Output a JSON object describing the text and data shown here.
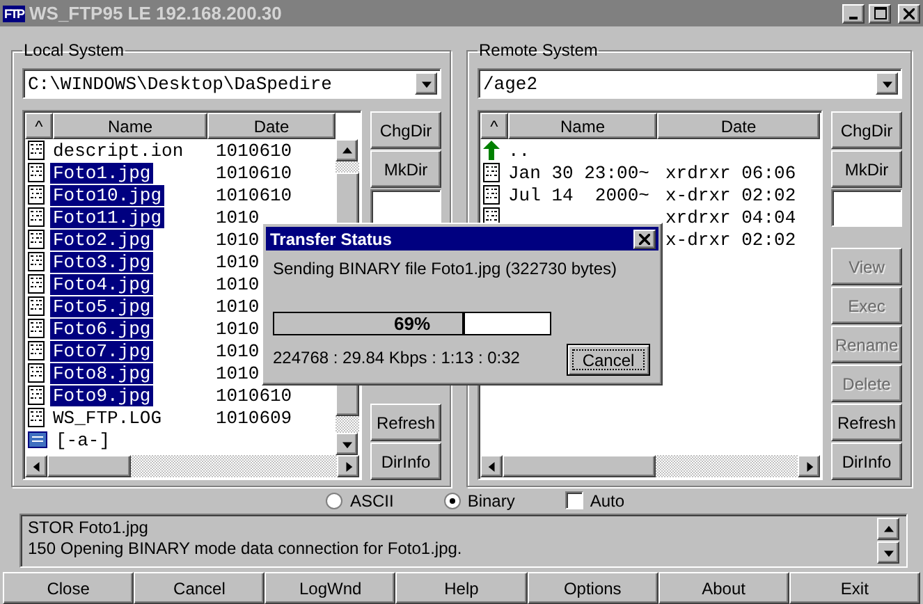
{
  "window": {
    "title": "WS_FTP95 LE 192.168.200.30",
    "logo": "FTP"
  },
  "local": {
    "title": "Local System",
    "path": "C:\\WINDOWS\\Desktop\\DaSpedire",
    "columns": [
      "^",
      "Name",
      "Date"
    ],
    "rows": [
      {
        "kind": "file",
        "name": "descript.ion",
        "date": "1010610",
        "selected": false
      },
      {
        "kind": "file",
        "name": "Foto1.jpg",
        "date": "1010610",
        "selected": true
      },
      {
        "kind": "file",
        "name": "Foto10.jpg",
        "date": "1010610",
        "selected": true
      },
      {
        "kind": "file",
        "name": "Foto11.jpg",
        "date": "1010",
        "selected": true
      },
      {
        "kind": "file",
        "name": "Foto2.jpg",
        "date": "1010",
        "selected": true
      },
      {
        "kind": "file",
        "name": "Foto3.jpg",
        "date": "1010",
        "selected": true
      },
      {
        "kind": "file",
        "name": "Foto4.jpg",
        "date": "1010",
        "selected": true
      },
      {
        "kind": "file",
        "name": "Foto5.jpg",
        "date": "1010",
        "selected": true
      },
      {
        "kind": "file",
        "name": "Foto6.jpg",
        "date": "1010",
        "selected": true
      },
      {
        "kind": "file",
        "name": "Foto7.jpg",
        "date": "1010",
        "selected": true
      },
      {
        "kind": "file",
        "name": "Foto8.jpg",
        "date": "1010",
        "selected": true
      },
      {
        "kind": "file",
        "name": "Foto9.jpg",
        "date": "1010610",
        "selected": true
      },
      {
        "kind": "file",
        "name": "WS_FTP.LOG",
        "date": "1010609",
        "selected": false
      },
      {
        "kind": "drive",
        "name": "[-a-]",
        "selected": false
      }
    ],
    "upper_buttons": [
      {
        "label": "ChgDir",
        "disabled": false
      },
      {
        "label": "MkDir",
        "disabled": false
      }
    ],
    "lower_buttons": [
      {
        "label": "Refresh",
        "disabled": false
      },
      {
        "label": "DirInfo",
        "disabled": false
      }
    ]
  },
  "remote": {
    "title": "Remote System",
    "path": "/age2",
    "columns": [
      "^",
      "Name",
      "Date"
    ],
    "rows": [
      {
        "kind": "up",
        "name": "..",
        "selected": false
      },
      {
        "kind": "file",
        "name": "Jan 30 23:00~",
        "date": "xrdrxr 06:06",
        "selected": false
      },
      {
        "kind": "file",
        "name": "Jul 14  2000~",
        "date": "x-drxr 02:02",
        "selected": false
      },
      {
        "kind": "file",
        "date": "xrdrxr 04:04"
      },
      {
        "kind": "covered",
        "date": "x-drxr 02:02"
      }
    ],
    "upper_buttons": [
      {
        "label": "ChgDir",
        "disabled": false
      },
      {
        "label": "MkDir",
        "disabled": false
      }
    ],
    "lower_buttons": [
      {
        "label": "View",
        "disabled": true
      },
      {
        "label": "Exec",
        "disabled": true
      },
      {
        "label": "Rename",
        "disabled": true
      },
      {
        "label": "Delete",
        "disabled": true
      },
      {
        "label": "Refresh",
        "disabled": false
      },
      {
        "label": "DirInfo",
        "disabled": false
      }
    ]
  },
  "mode": [
    {
      "label": "ASCII",
      "selected": false
    },
    {
      "label": "Binary",
      "selected": true
    }
  ],
  "auto": {
    "label": "Auto",
    "checked": false
  },
  "log": [
    "STOR Foto1.jpg",
    "150 Opening BINARY mode data connection for Foto1.jpg."
  ],
  "buttons": [
    "Close",
    "Cancel",
    "LogWnd",
    "Help",
    "Options",
    "About",
    "Exit"
  ],
  "dialog": {
    "title": "Transfer Status",
    "message": "Sending BINARY file Foto1.jpg (322730 bytes)",
    "progress": {
      "level": 0.69,
      "reading": "69%"
    },
    "stats": "224768 : 29.84 Kbps : 1:13 : 0:32",
    "button": "Cancel"
  }
}
